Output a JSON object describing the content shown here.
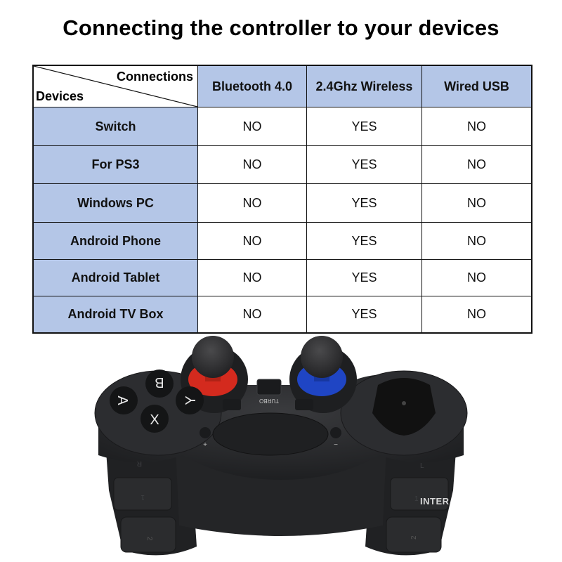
{
  "title": "Connecting the controller to your devices",
  "table": {
    "corner_top_label": "Connections",
    "corner_bottom_label": "Devices",
    "columns": [
      "Bluetooth 4.0",
      "2.4Ghz Wireless",
      "Wired USB"
    ],
    "rows": [
      {
        "device": "Switch",
        "values": [
          "NO",
          "YES",
          "NO"
        ]
      },
      {
        "device": "For PS3",
        "values": [
          "NO",
          "YES",
          "NO"
        ]
      },
      {
        "device": "Windows PC",
        "values": [
          "NO",
          "YES",
          "NO"
        ]
      },
      {
        "device": "Android Phone",
        "values": [
          "NO",
          "YES",
          "NO"
        ]
      },
      {
        "device": "Android Tablet",
        "values": [
          "NO",
          "YES",
          "NO"
        ]
      },
      {
        "device": "Android TV Box",
        "values": [
          "NO",
          "YES",
          "NO"
        ]
      }
    ]
  },
  "controller": {
    "face_buttons": [
      "B",
      "A",
      "Y",
      "X"
    ],
    "turbo_label": "TURBO",
    "plus_label": "+",
    "minus_label": "−",
    "trigger_labels": {
      "left_shoulder": "1",
      "left_trigger": "2",
      "right_shoulder": "1",
      "right_trigger": "2",
      "left_side": "R",
      "right_side": "L"
    },
    "left_stick_color": "#d42a1e",
    "right_stick_color": "#1f45c4",
    "body_color": "#2a2b2d"
  },
  "watermark": "INTER",
  "colors": {
    "header_bg": "#b4c6e7",
    "border": "#111111"
  }
}
